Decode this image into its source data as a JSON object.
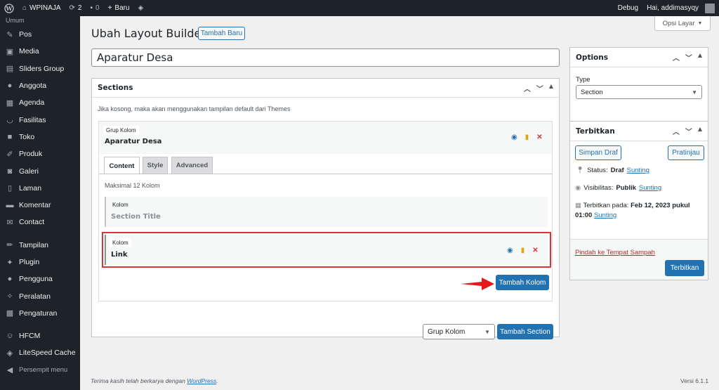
{
  "adminbar": {
    "site_name": "WPINAJA",
    "updates_count": "2",
    "comments_count": "0",
    "new_label": "Baru",
    "debug_label": "Debug",
    "greeting": "Hai, addimasyqy"
  },
  "sidebar": {
    "section_label": "Umum",
    "items": [
      {
        "label": "Pos",
        "icon": "pin-icon"
      },
      {
        "label": "Media",
        "icon": "media-icon"
      },
      {
        "label": "Sliders Group",
        "icon": "slides-icon"
      },
      {
        "label": "Anggota",
        "icon": "users-icon"
      },
      {
        "label": "Agenda",
        "icon": "calendar-icon"
      },
      {
        "label": "Fasilitas",
        "icon": "smiley-icon"
      },
      {
        "label": "Toko",
        "icon": "store-icon"
      },
      {
        "label": "Produk",
        "icon": "paint-icon"
      },
      {
        "label": "Galeri",
        "icon": "camera-icon"
      },
      {
        "label": "Laman",
        "icon": "pages-icon"
      },
      {
        "label": "Komentar",
        "icon": "comment-icon"
      },
      {
        "label": "Contact",
        "icon": "mail-icon"
      }
    ],
    "items2": [
      {
        "label": "Tampilan",
        "icon": "brush-icon"
      },
      {
        "label": "Plugin",
        "icon": "plugin-icon"
      },
      {
        "label": "Pengguna",
        "icon": "user-icon"
      },
      {
        "label": "Peralatan",
        "icon": "wrench-icon"
      },
      {
        "label": "Pengaturan",
        "icon": "settings-icon"
      }
    ],
    "items3": [
      {
        "label": "HFCM",
        "icon": "robot-icon"
      },
      {
        "label": "LiteSpeed Cache",
        "icon": "diamond-icon"
      }
    ],
    "collapse_label": "Persempit menu"
  },
  "header": {
    "title": "Ubah Layout Builder",
    "add_new_label": "Tambah Baru",
    "screen_options_label": "Opsi Layar"
  },
  "post_title": "Aparatur Desa",
  "sections": {
    "heading": "Sections",
    "hint": "Jika kosong, maka akan menggunakan tampilan default dari Themes",
    "grup": {
      "chip": "Grup Kolom",
      "title": "Aparatur Desa",
      "tabs": [
        "Content",
        "Style",
        "Advanced"
      ],
      "max_text": "Maksimal 12 Kolom",
      "kolom": [
        {
          "chip": "Kolom",
          "title": "Section Title"
        },
        {
          "chip": "Kolom",
          "title": "Link"
        }
      ],
      "add_kolom_label": "Tambah Kolom"
    },
    "select_value": "Grup Kolom",
    "add_section_label": "Tambah Section"
  },
  "options": {
    "heading": "Options",
    "type_label": "Type",
    "type_value": "Section"
  },
  "publish": {
    "heading": "Terbitkan",
    "save_draft": "Simpan Draf",
    "preview": "Pratinjau",
    "status_label": "Status:",
    "status_value": "Draf",
    "visibility_label": "Visibilitas:",
    "visibility_value": "Publik",
    "edit_link": "Sunting",
    "published_label": "Terbitkan pada:",
    "published_value": "Feb 12, 2023 pukul",
    "published_time": "01:00",
    "trash_link": "Pindah ke Tempat Sampah",
    "publish_button": "Terbitkan"
  },
  "footer": {
    "thanks_prefix": "Terima kasih telah berkarya dengan ",
    "wp_link": "WordPress",
    "thanks_suffix": ".",
    "version": "Versi 6.1.1"
  },
  "colors": {
    "accent": "#2271b1",
    "danger": "#d63638",
    "adminbar": "#1d2327"
  }
}
